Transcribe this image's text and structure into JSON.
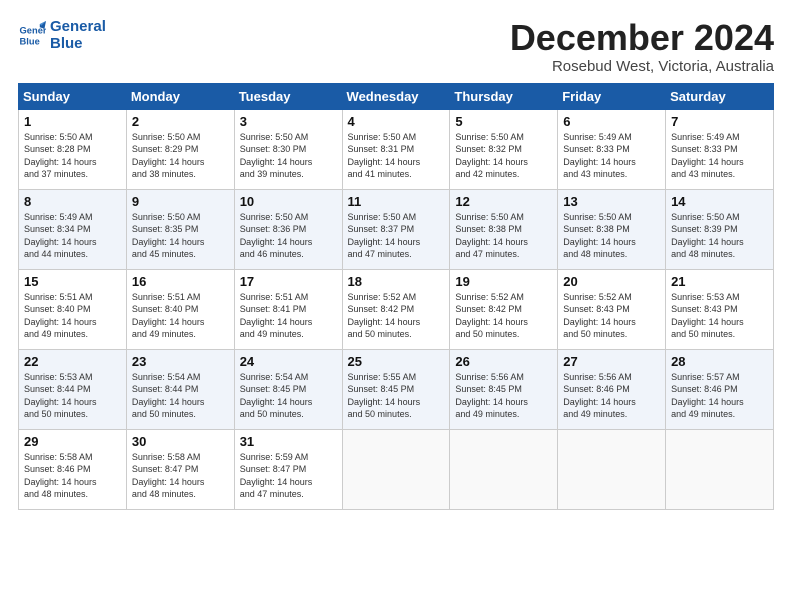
{
  "logo": {
    "line1": "General",
    "line2": "Blue"
  },
  "title": "December 2024",
  "subtitle": "Rosebud West, Victoria, Australia",
  "days_header": [
    "Sunday",
    "Monday",
    "Tuesday",
    "Wednesday",
    "Thursday",
    "Friday",
    "Saturday"
  ],
  "weeks": [
    [
      {
        "day": "1",
        "info": "Sunrise: 5:50 AM\nSunset: 8:28 PM\nDaylight: 14 hours\nand 37 minutes."
      },
      {
        "day": "2",
        "info": "Sunrise: 5:50 AM\nSunset: 8:29 PM\nDaylight: 14 hours\nand 38 minutes."
      },
      {
        "day": "3",
        "info": "Sunrise: 5:50 AM\nSunset: 8:30 PM\nDaylight: 14 hours\nand 39 minutes."
      },
      {
        "day": "4",
        "info": "Sunrise: 5:50 AM\nSunset: 8:31 PM\nDaylight: 14 hours\nand 41 minutes."
      },
      {
        "day": "5",
        "info": "Sunrise: 5:50 AM\nSunset: 8:32 PM\nDaylight: 14 hours\nand 42 minutes."
      },
      {
        "day": "6",
        "info": "Sunrise: 5:49 AM\nSunset: 8:33 PM\nDaylight: 14 hours\nand 43 minutes."
      },
      {
        "day": "7",
        "info": "Sunrise: 5:49 AM\nSunset: 8:33 PM\nDaylight: 14 hours\nand 43 minutes."
      }
    ],
    [
      {
        "day": "8",
        "info": "Sunrise: 5:49 AM\nSunset: 8:34 PM\nDaylight: 14 hours\nand 44 minutes."
      },
      {
        "day": "9",
        "info": "Sunrise: 5:50 AM\nSunset: 8:35 PM\nDaylight: 14 hours\nand 45 minutes."
      },
      {
        "day": "10",
        "info": "Sunrise: 5:50 AM\nSunset: 8:36 PM\nDaylight: 14 hours\nand 46 minutes."
      },
      {
        "day": "11",
        "info": "Sunrise: 5:50 AM\nSunset: 8:37 PM\nDaylight: 14 hours\nand 47 minutes."
      },
      {
        "day": "12",
        "info": "Sunrise: 5:50 AM\nSunset: 8:38 PM\nDaylight: 14 hours\nand 47 minutes."
      },
      {
        "day": "13",
        "info": "Sunrise: 5:50 AM\nSunset: 8:38 PM\nDaylight: 14 hours\nand 48 minutes."
      },
      {
        "day": "14",
        "info": "Sunrise: 5:50 AM\nSunset: 8:39 PM\nDaylight: 14 hours\nand 48 minutes."
      }
    ],
    [
      {
        "day": "15",
        "info": "Sunrise: 5:51 AM\nSunset: 8:40 PM\nDaylight: 14 hours\nand 49 minutes."
      },
      {
        "day": "16",
        "info": "Sunrise: 5:51 AM\nSunset: 8:40 PM\nDaylight: 14 hours\nand 49 minutes."
      },
      {
        "day": "17",
        "info": "Sunrise: 5:51 AM\nSunset: 8:41 PM\nDaylight: 14 hours\nand 49 minutes."
      },
      {
        "day": "18",
        "info": "Sunrise: 5:52 AM\nSunset: 8:42 PM\nDaylight: 14 hours\nand 50 minutes."
      },
      {
        "day": "19",
        "info": "Sunrise: 5:52 AM\nSunset: 8:42 PM\nDaylight: 14 hours\nand 50 minutes."
      },
      {
        "day": "20",
        "info": "Sunrise: 5:52 AM\nSunset: 8:43 PM\nDaylight: 14 hours\nand 50 minutes."
      },
      {
        "day": "21",
        "info": "Sunrise: 5:53 AM\nSunset: 8:43 PM\nDaylight: 14 hours\nand 50 minutes."
      }
    ],
    [
      {
        "day": "22",
        "info": "Sunrise: 5:53 AM\nSunset: 8:44 PM\nDaylight: 14 hours\nand 50 minutes."
      },
      {
        "day": "23",
        "info": "Sunrise: 5:54 AM\nSunset: 8:44 PM\nDaylight: 14 hours\nand 50 minutes."
      },
      {
        "day": "24",
        "info": "Sunrise: 5:54 AM\nSunset: 8:45 PM\nDaylight: 14 hours\nand 50 minutes."
      },
      {
        "day": "25",
        "info": "Sunrise: 5:55 AM\nSunset: 8:45 PM\nDaylight: 14 hours\nand 50 minutes."
      },
      {
        "day": "26",
        "info": "Sunrise: 5:56 AM\nSunset: 8:45 PM\nDaylight: 14 hours\nand 49 minutes."
      },
      {
        "day": "27",
        "info": "Sunrise: 5:56 AM\nSunset: 8:46 PM\nDaylight: 14 hours\nand 49 minutes."
      },
      {
        "day": "28",
        "info": "Sunrise: 5:57 AM\nSunset: 8:46 PM\nDaylight: 14 hours\nand 49 minutes."
      }
    ],
    [
      {
        "day": "29",
        "info": "Sunrise: 5:58 AM\nSunset: 8:46 PM\nDaylight: 14 hours\nand 48 minutes."
      },
      {
        "day": "30",
        "info": "Sunrise: 5:58 AM\nSunset: 8:47 PM\nDaylight: 14 hours\nand 48 minutes."
      },
      {
        "day": "31",
        "info": "Sunrise: 5:59 AM\nSunset: 8:47 PM\nDaylight: 14 hours\nand 47 minutes."
      },
      null,
      null,
      null,
      null
    ]
  ]
}
